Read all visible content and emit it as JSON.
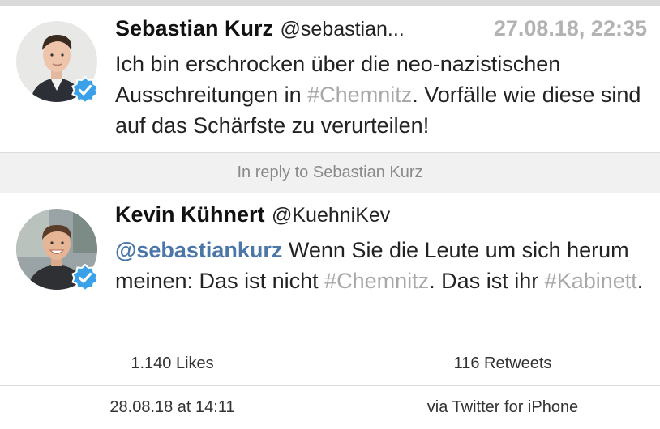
{
  "tweet1": {
    "name": "Sebastian Kurz",
    "handle": "@sebastian...",
    "timestamp": "27.08.18, 22:35",
    "text_parts": [
      "Ich bin erschrocken über die neo-nazistischen Ausschreitungen in ",
      "#Chemnitz",
      ". Vorfälle wie diese sind auf das Schärfste zu verurteilen!"
    ]
  },
  "reply_label": "In reply to Sebastian Kurz",
  "tweet2": {
    "name": "Kevin Kühnert",
    "handle": "@KuehniKev",
    "text_parts": [
      "@sebastiankurz",
      " Wenn Sie die Leute um sich herum meinen: Das ist nicht ",
      "#Chemnitz",
      ". Das ist ihr ",
      "#Kabinett",
      "."
    ]
  },
  "stats": {
    "likes": "1.140 Likes",
    "retweets": "116 Retweets",
    "date": "28.08.18 at 14:11",
    "source": "via Twitter for iPhone"
  },
  "icons": {
    "verified": "verified-badge-icon"
  },
  "colors": {
    "hashtag": "#a8a8a8",
    "mention": "#4a76a8",
    "verified": "#3aa0e8",
    "timestamp": "#b3b3b3"
  }
}
